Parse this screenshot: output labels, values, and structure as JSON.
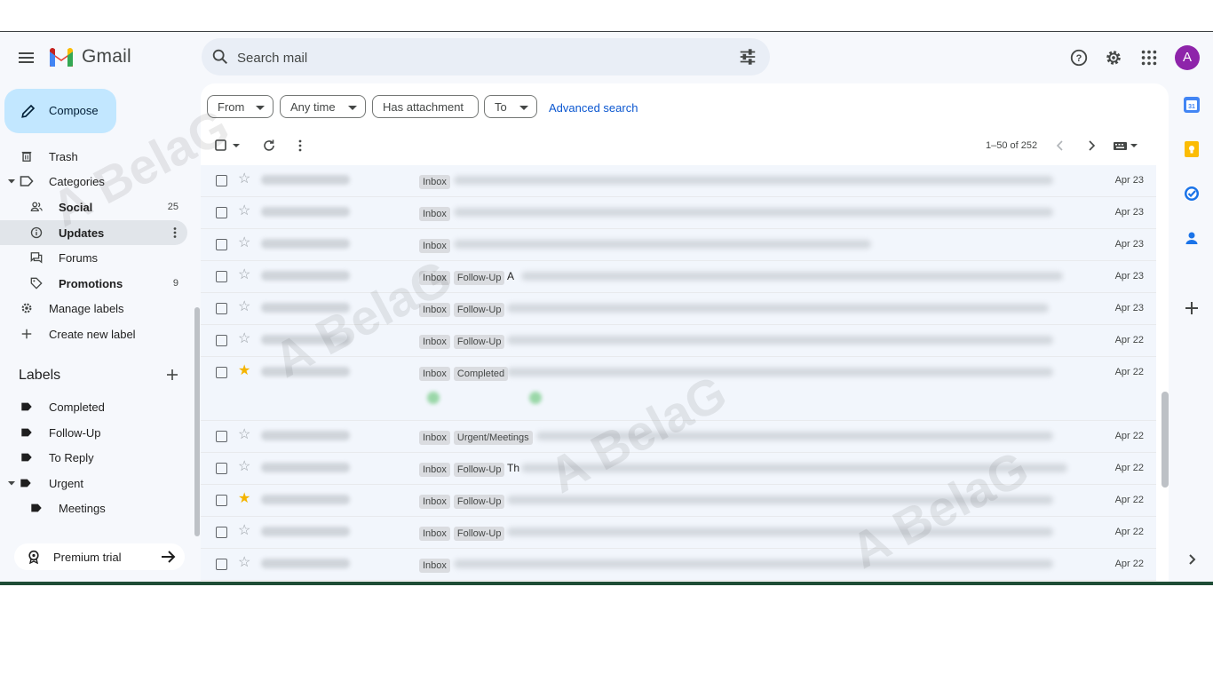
{
  "app": {
    "name": "Gmail"
  },
  "search": {
    "placeholder": "Search mail"
  },
  "avatar": {
    "letter": "A",
    "color": "#8e24aa"
  },
  "compose": {
    "label": "Compose"
  },
  "sidebar": {
    "items": [
      {
        "label": "Trash",
        "count": ""
      },
      {
        "label": "Categories",
        "count": ""
      },
      {
        "label": "Social",
        "count": "25"
      },
      {
        "label": "Updates",
        "count": ""
      },
      {
        "label": "Forums",
        "count": ""
      },
      {
        "label": "Promotions",
        "count": "9"
      },
      {
        "label": "Manage labels",
        "count": ""
      },
      {
        "label": "Create new label",
        "count": ""
      }
    ],
    "labels_heading": "Labels",
    "labels": [
      "Completed",
      "Follow-Up",
      "To Reply",
      "Urgent",
      "Meetings"
    ],
    "premium": "Premium trial"
  },
  "filters": {
    "chips": [
      "From",
      "Any time",
      "Has attachment",
      "To"
    ],
    "advanced": "Advanced search"
  },
  "pager": {
    "text": "1–50 of 252"
  },
  "rows": [
    {
      "tags": [
        "Inbox"
      ],
      "date": "Apr 23",
      "starred": false,
      "lead": ""
    },
    {
      "tags": [
        "Inbox"
      ],
      "date": "Apr 23",
      "starred": false,
      "lead": ""
    },
    {
      "tags": [
        "Inbox"
      ],
      "date": "Apr 23",
      "starred": false,
      "lead": ""
    },
    {
      "tags": [
        "Inbox",
        "Follow-Up"
      ],
      "date": "Apr 23",
      "starred": false,
      "lead": "A"
    },
    {
      "tags": [
        "Inbox",
        "Follow-Up"
      ],
      "date": "Apr 23",
      "starred": false,
      "lead": ""
    },
    {
      "tags": [
        "Inbox",
        "Follow-Up"
      ],
      "date": "Apr 22",
      "starred": false,
      "lead": ""
    },
    {
      "tags": [
        "Inbox",
        "Completed"
      ],
      "date": "Apr 22",
      "starred": true,
      "lead": ""
    },
    {
      "tags": [
        "Inbox",
        "Urgent/Meetings"
      ],
      "date": "Apr 22",
      "starred": false,
      "lead": ""
    },
    {
      "tags": [
        "Inbox",
        "Follow-Up"
      ],
      "date": "Apr 22",
      "starred": false,
      "lead": "Th"
    },
    {
      "tags": [
        "Inbox",
        "Follow-Up"
      ],
      "date": "Apr 22",
      "starred": true,
      "lead": ""
    },
    {
      "tags": [
        "Inbox",
        "Follow-Up"
      ],
      "date": "Apr 22",
      "starred": false,
      "lead": ""
    },
    {
      "tags": [
        "Inbox"
      ],
      "date": "Apr 22",
      "starred": false,
      "lead": ""
    }
  ],
  "watermark": "A BelaG",
  "colors": {
    "accent": "#0b57d0",
    "compose_bg": "#c2e7ff",
    "star": "#f4b400"
  }
}
